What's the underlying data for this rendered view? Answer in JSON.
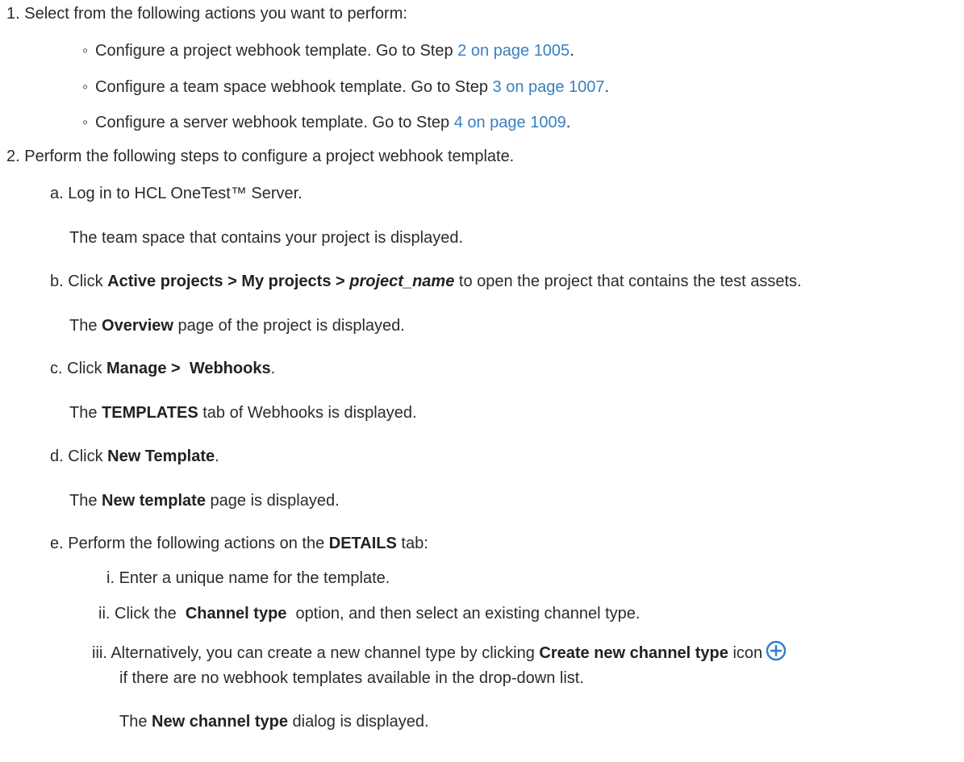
{
  "step1": {
    "num": "1.",
    "text": "Select from the following actions you want to perform:",
    "bullets": [
      {
        "pre": "Configure a project webhook template. Go to Step ",
        "link": "2 on page 1005",
        "post": "."
      },
      {
        "pre": "Configure a team space webhook template. Go to Step ",
        "link": "3 on page 1007",
        "post": "."
      },
      {
        "pre": "Configure a server webhook template. Go to Step ",
        "link": "4 on page 1009",
        "post": "."
      }
    ]
  },
  "step2": {
    "num": "2.",
    "text": "Perform the following steps to configure a project webhook template.",
    "a": {
      "label": "a.",
      "text": "Log in to HCL OneTest™ Server.",
      "result": "The team space that contains your project is displayed."
    },
    "b": {
      "label": "b.",
      "pre": "Click ",
      "bold": "Active projects > My projects > ",
      "bold_italic": "project_name",
      "post": " to open the project that contains the test assets.",
      "result_pre": "The ",
      "result_bold": "Overview",
      "result_post": " page of the project is displayed."
    },
    "c": {
      "label": "c.",
      "pre": "Click ",
      "bold": "Manage >  Webhooks",
      "post": ".",
      "result_pre": "The ",
      "result_bold": "TEMPLATES",
      "result_post": " tab of Webhooks is displayed."
    },
    "d": {
      "label": "d.",
      "pre": "Click ",
      "bold": "New Template",
      "post": ".",
      "result_pre": "The ",
      "result_bold": "New template",
      "result_post": " page is displayed."
    },
    "e": {
      "label": "e.",
      "pre": "Perform the following actions on the ",
      "bold": "DETAILS",
      "post": " tab:",
      "i": {
        "label": "i.",
        "text": "Enter a unique name for the template."
      },
      "ii": {
        "label": "ii.",
        "pre": "Click the  ",
        "bold": "Channel type",
        "post": "  option, and then select an existing channel type."
      },
      "iii": {
        "label": "iii.",
        "pre": "Alternatively, you can create a new channel type by clicking ",
        "bold": "Create new channel type",
        "post": " icon",
        "line2": "if there are no webhook templates available in the drop-down list.",
        "result_pre": "The ",
        "result_bold": "New channel type",
        "result_post": " dialog is displayed."
      }
    }
  },
  "colors": {
    "link": "#3a7fc1",
    "text": "#2b2b2b",
    "icon": "#2f7fc8"
  }
}
